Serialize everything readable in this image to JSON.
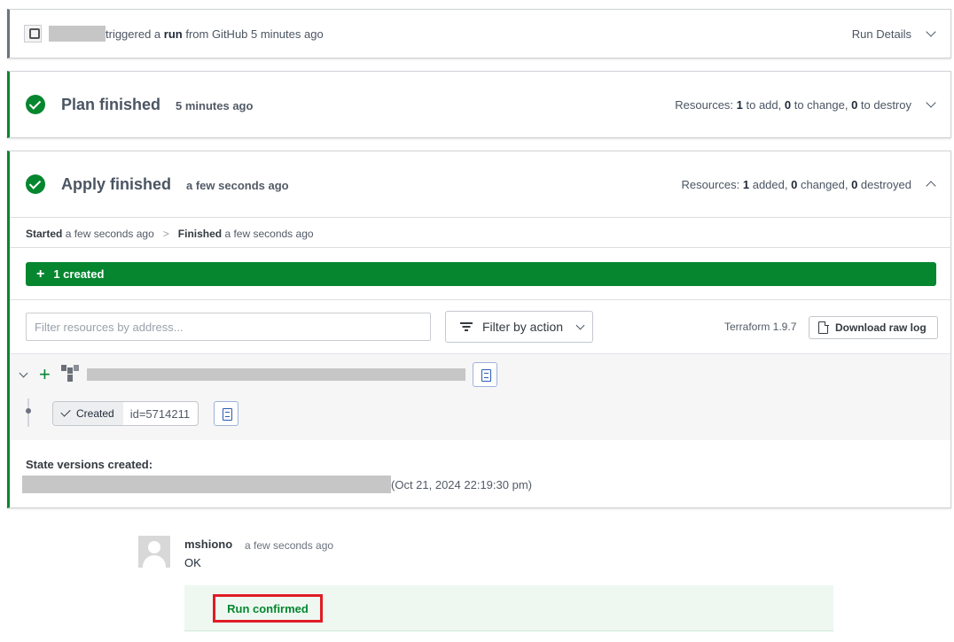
{
  "trigger": {
    "text_before": "triggered a ",
    "run_word": "run",
    "text_after": " from GitHub 5 minutes ago",
    "details_label": "Run Details"
  },
  "plan": {
    "title": "Plan finished",
    "time": "5 minutes ago",
    "resources_prefix": "Resources: ",
    "add_count": "1",
    "add_label": " to add, ",
    "change_count": "0",
    "change_label": " to change, ",
    "destroy_count": "0",
    "destroy_label": " to destroy"
  },
  "apply": {
    "title": "Apply finished",
    "time": "a few seconds ago",
    "resources_prefix": "Resources: ",
    "added_count": "1",
    "added_label": " added, ",
    "changed_count": "0",
    "changed_label": " changed, ",
    "destroyed_count": "0",
    "destroyed_label": " destroyed",
    "started_label": "Started",
    "started_time": "a few seconds ago",
    "separator": ">",
    "finished_label": "Finished",
    "finished_time": "a few seconds ago",
    "created_bar_label": "1 created",
    "filter_placeholder": "Filter resources by address...",
    "filter_action_label": "Filter by action",
    "terraform_version": "Terraform 1.9.7",
    "download_label": "Download raw log",
    "resource": {
      "status_label": "Created",
      "id_text": "id=5714211"
    },
    "state_versions_title": "State versions created:",
    "state_version_time": "(Oct 21, 2024 22:19:30 pm)"
  },
  "comment": {
    "user": "mshiono",
    "time": "a few seconds ago",
    "text": "OK",
    "confirm_label": "Run confirmed"
  },
  "colors": {
    "success_green": "#05862f",
    "highlight_red": "#e01c24",
    "link_blue": "#2b59b5"
  }
}
